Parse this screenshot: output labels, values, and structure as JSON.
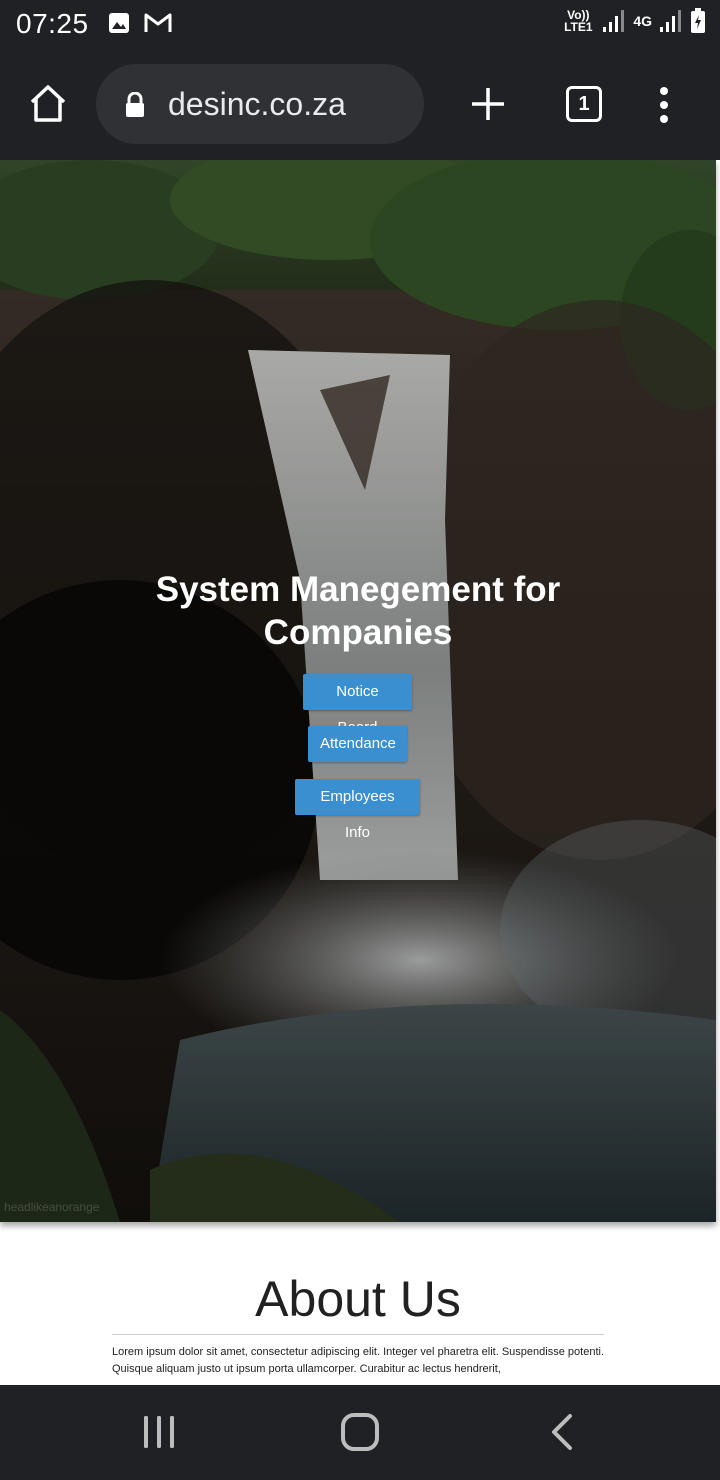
{
  "status_bar": {
    "time": "07:25",
    "left_icons": [
      "gallery-icon",
      "gmail-icon"
    ],
    "network_1": "Vo)) LTE1",
    "network_2": "4G",
    "battery_level": 0.7
  },
  "browser": {
    "url": "desinc.co.za",
    "tab_count": "1",
    "icons": [
      "home-icon",
      "lock-icon",
      "plus-icon",
      "tabs-icon",
      "more-vert-icon"
    ]
  },
  "hero": {
    "title": "System Manegement for Companies",
    "buttons": {
      "notice_board": "Notice Board",
      "attendance": "Attendance",
      "employees_info": "Employees Info"
    },
    "button_color": "#3a8fd1",
    "photo_credit": "headlikeanorange"
  },
  "about": {
    "title": "About Us",
    "text": "Lorem ipsum dolor sit amet, consectetur adipiscing elit. Integer vel pharetra elit. Suspendisse potenti. Quisque aliquam justo ut ipsum porta ullamcorper. Curabitur ac lectus hendrerit,"
  },
  "nav_bar": {
    "icons": [
      "recents-icon",
      "home-circle-icon",
      "back-icon"
    ]
  }
}
